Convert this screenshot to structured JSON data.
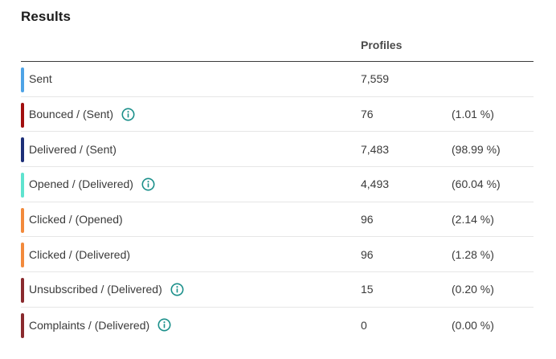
{
  "results": {
    "title": "Results",
    "column_header": "Profiles",
    "rows": [
      {
        "label": "Sent",
        "count": "7,559",
        "percent": "",
        "color": "#4ea3e6",
        "info": false
      },
      {
        "label": "Bounced / (Sent)",
        "count": "76",
        "percent": "(1.01 %)",
        "color": "#a10f0f",
        "info": true
      },
      {
        "label": "Delivered / (Sent)",
        "count": "7,483",
        "percent": "(98.99 %)",
        "color": "#1d2f78",
        "info": false
      },
      {
        "label": "Opened / (Delivered)",
        "count": "4,493",
        "percent": "(60.04 %)",
        "color": "#5fe3cf",
        "info": true
      },
      {
        "label": "Clicked / (Opened)",
        "count": "96",
        "percent": "(2.14 %)",
        "color": "#f28a3c",
        "info": false
      },
      {
        "label": "Clicked / (Delivered)",
        "count": "96",
        "percent": "(1.28 %)",
        "color": "#f28a3c",
        "info": false
      },
      {
        "label": "Unsubscribed / (Delivered)",
        "count": "15",
        "percent": "(0.20 %)",
        "color": "#8a2a2e",
        "info": true
      },
      {
        "label": "Complaints / (Delivered)",
        "count": "0",
        "percent": "(0.00 %)",
        "color": "#8a2a2e",
        "info": true
      }
    ],
    "info_icon_color": "#1a8f8a",
    "info_icon_name": "info-icon"
  }
}
